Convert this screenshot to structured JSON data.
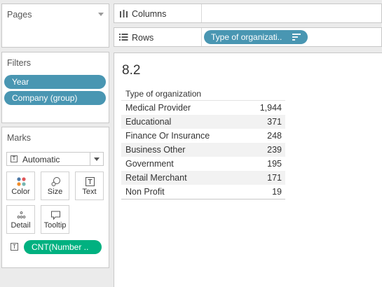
{
  "cards": {
    "pages": {
      "title": "Pages"
    },
    "filters": {
      "title": "Filters",
      "pills": [
        "Year",
        "Company (group)"
      ]
    },
    "marks": {
      "title": "Marks",
      "mark_type": "Automatic",
      "buttons": [
        "Color",
        "Size",
        "Text",
        "Detail",
        "Tooltip"
      ],
      "field_pill": "CNT(Number .."
    }
  },
  "shelves": {
    "columns": {
      "label": "Columns"
    },
    "rows": {
      "label": "Rows",
      "pill": "Type of organizati.."
    }
  },
  "view": {
    "title": "8.2",
    "table": {
      "header": "Type of organization",
      "rows": [
        {
          "category": "Medical Provider",
          "value": "1,944"
        },
        {
          "category": "Educational",
          "value": "371"
        },
        {
          "category": "Finance Or Insurance",
          "value": "248"
        },
        {
          "category": "Business Other",
          "value": "239"
        },
        {
          "category": "Government",
          "value": "195"
        },
        {
          "category": "Retail Merchant",
          "value": "171"
        },
        {
          "category": "Non Profit",
          "value": "19"
        }
      ]
    }
  },
  "colors": {
    "dimension_pill": "#4996b2",
    "measure_pill": "#00b180",
    "color_dots": [
      "#4e79a7",
      "#e15759",
      "#f28e2b",
      "#76b7b2"
    ]
  }
}
